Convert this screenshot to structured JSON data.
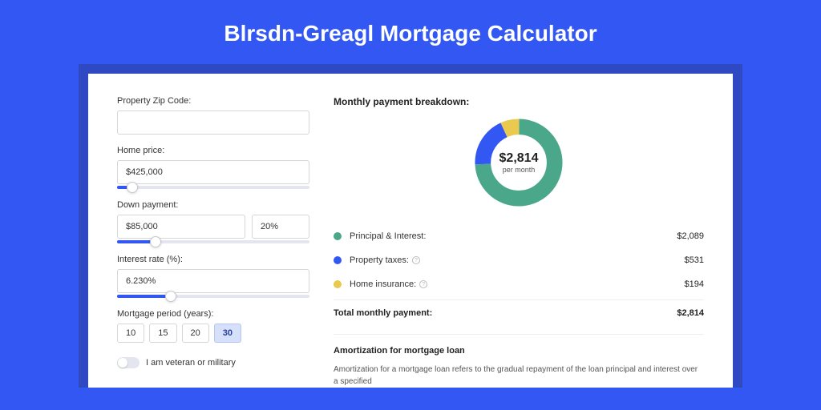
{
  "title": "Blrsdn-Greagl Mortgage Calculator",
  "colors": {
    "principal": "#4aa789",
    "taxes": "#3357f2",
    "insurance": "#e9c94e"
  },
  "form": {
    "zip_label": "Property Zip Code:",
    "zip_value": "",
    "home_price_label": "Home price:",
    "home_price_value": "$425,000",
    "home_price_slider_pct": 8,
    "down_payment_label": "Down payment:",
    "down_payment_value": "$85,000",
    "down_payment_pct": "20%",
    "down_payment_slider_pct": 20,
    "interest_label": "Interest rate (%):",
    "interest_value": "6.230%",
    "interest_slider_pct": 28,
    "period_label": "Mortgage period (years):",
    "period_options": [
      "10",
      "15",
      "20",
      "30"
    ],
    "period_selected": "30",
    "veteran_label": "I am veteran or military"
  },
  "breakdown": {
    "title": "Monthly payment breakdown:",
    "center_amount": "$2,814",
    "center_sub": "per month",
    "items": [
      {
        "label": "Principal & Interest:",
        "value": "$2,089",
        "info": false
      },
      {
        "label": "Property taxes:",
        "value": "$531",
        "info": true
      },
      {
        "label": "Home insurance:",
        "value": "$194",
        "info": true
      }
    ],
    "total_label": "Total monthly payment:",
    "total_value": "$2,814"
  },
  "amortization": {
    "title": "Amortization for mortgage loan",
    "text": "Amortization for a mortgage loan refers to the gradual repayment of the loan principal and interest over a specified"
  },
  "chart_data": {
    "type": "pie",
    "title": "Monthly payment breakdown",
    "series": [
      {
        "name": "Principal & Interest",
        "value": 2089
      },
      {
        "name": "Property taxes",
        "value": 531
      },
      {
        "name": "Home insurance",
        "value": 194
      }
    ],
    "total": 2814
  }
}
